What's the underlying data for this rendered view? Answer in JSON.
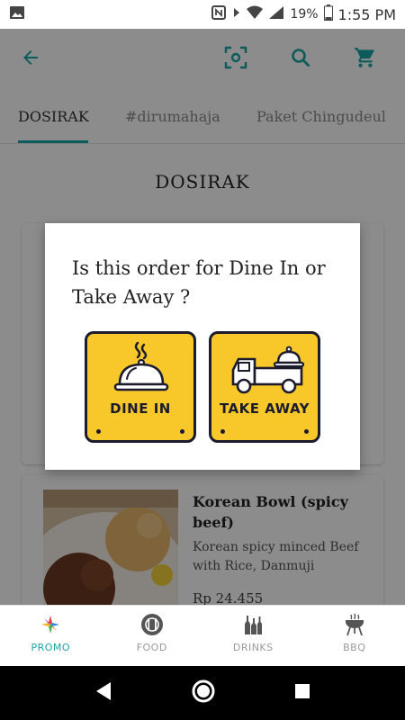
{
  "status_bar": {
    "battery": "19%",
    "time": "1:55 PM"
  },
  "app_bar": {
    "icons": [
      "back-arrow-icon",
      "scan-icon",
      "search-icon",
      "cart-icon"
    ]
  },
  "tabs": [
    {
      "label": "DOSIRAK",
      "active": true
    },
    {
      "label": "#dirumahaja",
      "active": false
    },
    {
      "label": "Paket Chingudeul",
      "active": false
    }
  ],
  "section": {
    "title": "DOSIRAK"
  },
  "menu_items": [
    {
      "title": "Korean Bowl (spicy beef)",
      "description": "Korean spicy minced Beef with Rice, Danmuji",
      "price": "Rp 24.455"
    }
  ],
  "dialog": {
    "question": "Is this order for Dine In or Take Away ?",
    "options": [
      {
        "label": "DINE IN",
        "icon": "cloche-icon"
      },
      {
        "label": "TAKE AWAY",
        "icon": "delivery-truck-icon"
      }
    ]
  },
  "bottom_nav": [
    {
      "label": "PROMO",
      "icon": "promo-logo-icon",
      "active": true
    },
    {
      "label": "FOOD",
      "icon": "plate-cutlery-icon",
      "active": false
    },
    {
      "label": "DRINKS",
      "icon": "bottles-icon",
      "active": false
    },
    {
      "label": "BBQ",
      "icon": "grill-icon",
      "active": false
    }
  ],
  "colors": {
    "accent": "#1aa7a7",
    "choice_bg": "#f8c72a",
    "outline": "#1b1b2e"
  }
}
